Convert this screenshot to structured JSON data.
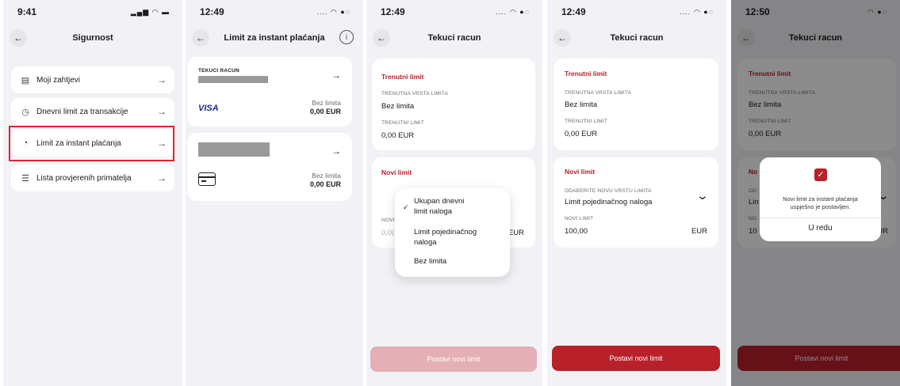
{
  "colors": {
    "accent": "#b8202a",
    "button": "#b8202a",
    "button_disabled": "#e4b0b5",
    "highlight": "#e0242c"
  },
  "screen1": {
    "time": "9:41",
    "title": "Sigurnost",
    "items": [
      {
        "label": "Moji zahtjevi",
        "icon": "document-icon"
      },
      {
        "label": "Dnevni limit za transakcije",
        "icon": "clock-icon"
      },
      {
        "label": "Limit za instant plaćanja",
        "icon": "gauge-icon"
      },
      {
        "label": "Lista provjerenih primatelja",
        "icon": "list-check-icon"
      }
    ]
  },
  "screen2": {
    "time": "12:49",
    "title": "Limit za instant plaćanja",
    "account_label": "TEKUCI RACUN",
    "visa_label": "VISA",
    "no_limit": "Bez limita",
    "amount": "0,00 EUR"
  },
  "screen3": {
    "time": "12:49",
    "title": "Tekuci racun",
    "current_limit_title": "Trenutni limit",
    "limit_type_label": "TRENUTNA VRSTA LIMITA",
    "limit_type_value": "Bez limita",
    "current_limit_label": "TRENUTNI LIMIT",
    "current_limit_value": "0,00 EUR",
    "new_limit_title": "Novi limit",
    "new_limit_label_partial": "NOVI",
    "new_limit_value_partial": "0,0(",
    "currency": "EUR",
    "dropdown_options": [
      {
        "label_line1": "Ukupan dnevni",
        "label_line2": "limit naloga",
        "selected": true
      },
      {
        "label_line1": "Limit pojedinačnog",
        "label_line2": "naloga",
        "selected": false
      },
      {
        "label_line1": "Bez limita",
        "label_line2": "",
        "selected": false
      }
    ],
    "button": "Postavi novi limit"
  },
  "screen4": {
    "time": "12:49",
    "title": "Tekuci racun",
    "current_limit_title": "Trenutni limit",
    "limit_type_label": "TRENUTNA VRSTA LIMITA",
    "limit_type_value": "Bez limita",
    "current_limit_label": "TRENUTNI LIMIT",
    "current_limit_value": "0,00 EUR",
    "new_limit_title": "Novi limit",
    "choose_type_label": "ODABERITE NOVU VRSTU LIMITA",
    "choose_type_value": "Limit pojedinačnog naloga",
    "new_limit_label": "NOVI LIMIT",
    "new_limit_value": "100,00",
    "currency": "EUR",
    "button": "Postavi novi limit"
  },
  "screen5": {
    "time": "12:50",
    "title": "Tekuci racun",
    "current_limit_title": "Trenutni limit",
    "limit_type_label": "TRENUTNA VRSTA LIMITA",
    "limit_type_value": "Bez limita",
    "current_limit_label": "TRENUTNI LIMIT",
    "current_limit_value": "0,00 EUR",
    "partial_new": "No",
    "partial_od": "OD",
    "partial_lin": "Lin",
    "partial_no": "NO",
    "partial_10": "10",
    "partial_ur": "UR",
    "dialog_text_line1": "Novi limit za instant plaćanja",
    "dialog_text_line2": "uspješno je postavljen.",
    "dialog_button": "U redu",
    "button": "Postavi novi limit"
  }
}
